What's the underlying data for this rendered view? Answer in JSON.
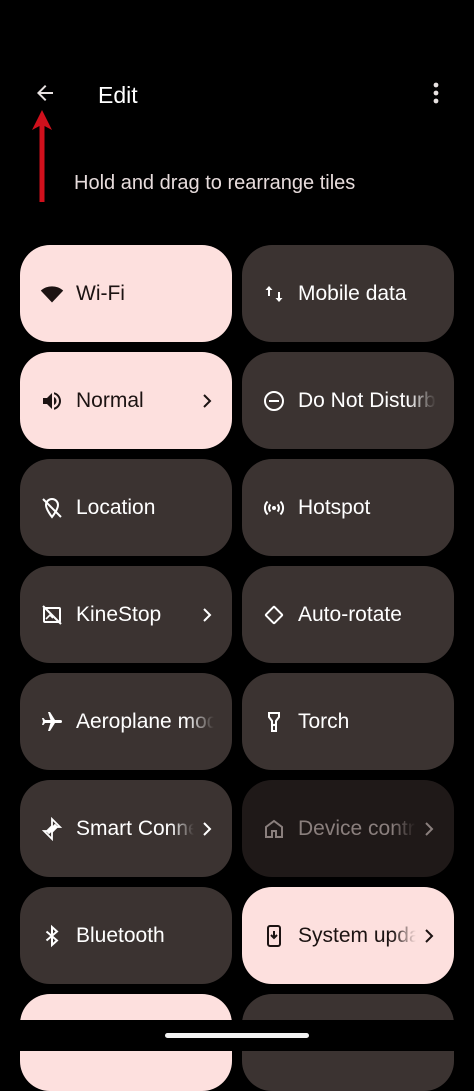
{
  "header": {
    "title": "Edit",
    "subtitle": "Hold and drag to rearrange tiles"
  },
  "tiles": [
    {
      "label": "Wi-Fi",
      "icon": "wifi-icon",
      "state": "active"
    },
    {
      "label": "Mobile data",
      "icon": "mobile-data-icon",
      "state": "inactive"
    },
    {
      "label": "Normal",
      "icon": "volume-icon",
      "state": "active",
      "chevron": true
    },
    {
      "label": "Do Not Disturb",
      "icon": "do-not-disturb-icon",
      "state": "inactive"
    },
    {
      "label": "Location",
      "icon": "location-off-icon",
      "state": "inactive"
    },
    {
      "label": "Hotspot",
      "icon": "hotspot-icon",
      "state": "inactive"
    },
    {
      "label": "KineStop",
      "icon": "kinestop-icon",
      "state": "inactive",
      "chevron": true
    },
    {
      "label": "Auto-rotate",
      "icon": "auto-rotate-icon",
      "state": "inactive"
    },
    {
      "label": "Aeroplane mode",
      "icon": "airplane-icon",
      "state": "inactive"
    },
    {
      "label": "Torch",
      "icon": "torch-icon",
      "state": "inactive"
    },
    {
      "label": "Smart Connect",
      "icon": "smart-connect-icon",
      "state": "inactive",
      "chevron": true
    },
    {
      "label": "Device controls",
      "icon": "home-icon",
      "state": "unavailable",
      "chevron": true
    },
    {
      "label": "Bluetooth",
      "icon": "bluetooth-icon",
      "state": "inactive"
    },
    {
      "label": "System update",
      "icon": "system-update-icon",
      "state": "active",
      "chevron": true
    }
  ],
  "colors": {
    "background": "#000000",
    "tile_active": "#fde0de",
    "tile_inactive": "#3b3331",
    "tile_unavailable": "#1f1918",
    "annotation_arrow": "#d0101c"
  }
}
